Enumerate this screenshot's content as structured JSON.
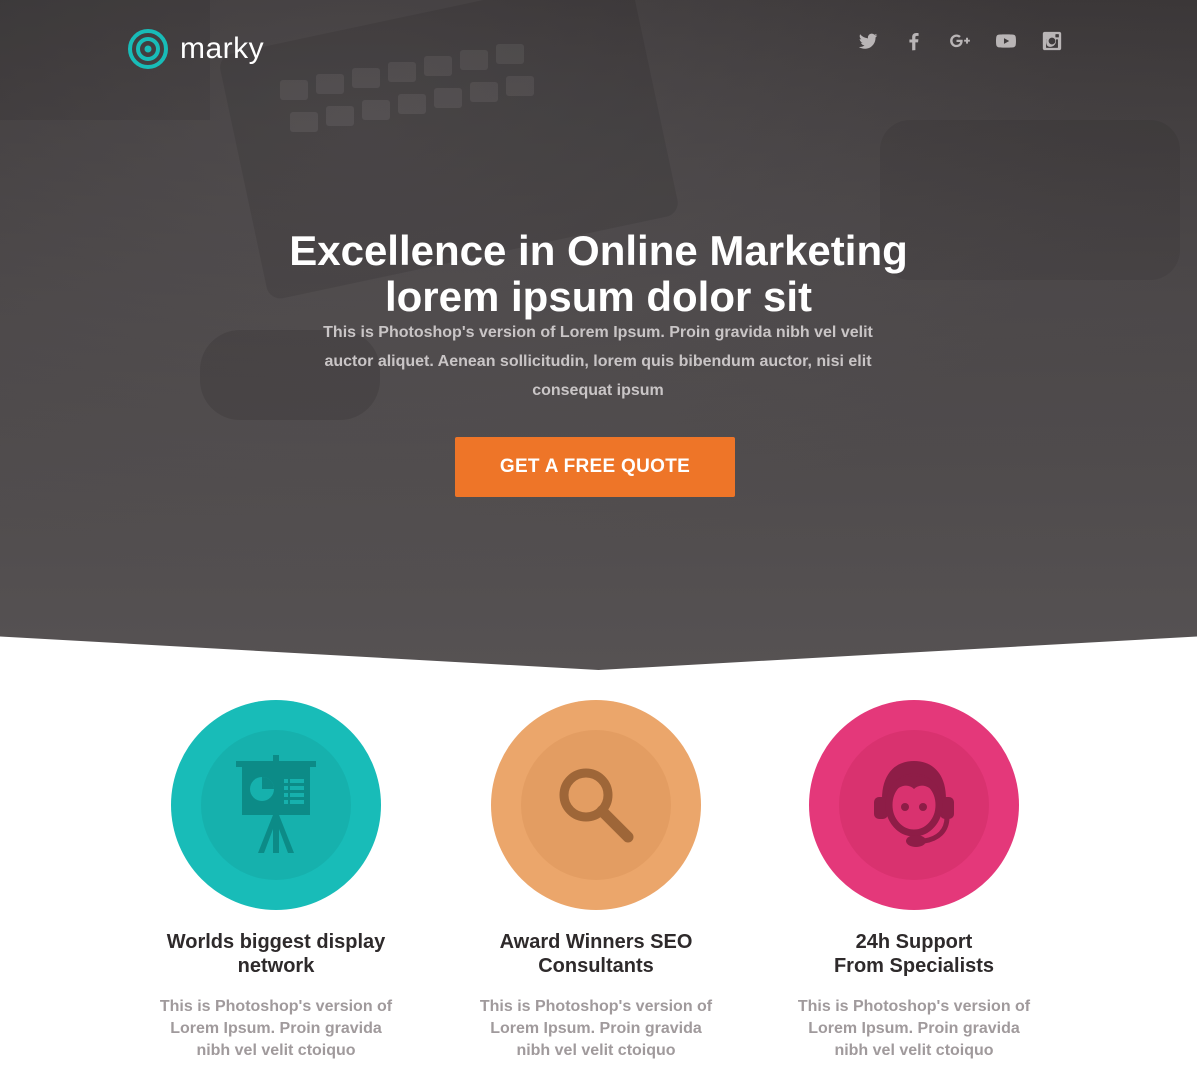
{
  "brand": {
    "name": "marky",
    "accent": "#18bcb8"
  },
  "social": [
    {
      "name": "twitter-icon"
    },
    {
      "name": "facebook-icon"
    },
    {
      "name": "google-plus-icon"
    },
    {
      "name": "youtube-icon"
    },
    {
      "name": "instagram-icon"
    }
  ],
  "hero": {
    "title_line1": "Excellence in Online Marketing",
    "title_line2": "lorem ipsum dolor sit",
    "lead_line1": "This is Photoshop's version of Lorem Ipsum. Proin gravida nibh vel velit",
    "lead_line2": "auctor aliquet. Aenean sollicitudin, lorem quis bibendum auctor, nisi elit",
    "lead_line3": "consequat ipsum",
    "cta_label": "GET A FREE QUOTE",
    "cta_color": "#ee7528"
  },
  "features": [
    {
      "icon": "presentation-board-icon",
      "color": "#18bcb8",
      "title_line1": "Worlds biggest display",
      "title_line2": "network",
      "text_line1": "This is Photoshop's version of",
      "text_line2": "Lorem Ipsum. Proin gravida",
      "text_line3": "nibh vel velit ctoiquo"
    },
    {
      "icon": "magnifier-icon",
      "color": "#eba66b",
      "title_line1": "Award Winners SEO",
      "title_line2": "Consultants",
      "text_line1": "This is Photoshop's version of",
      "text_line2": "Lorem Ipsum. Proin gravida",
      "text_line3": "nibh vel velit ctoiquo"
    },
    {
      "icon": "support-headset-icon",
      "color": "#e4387a",
      "title_line1": "24h Support",
      "title_line2": "From Specialists",
      "text_line1": "This is Photoshop's version of",
      "text_line2": "Lorem Ipsum. Proin gravida",
      "text_line3": "nibh vel velit ctoiquo"
    }
  ]
}
